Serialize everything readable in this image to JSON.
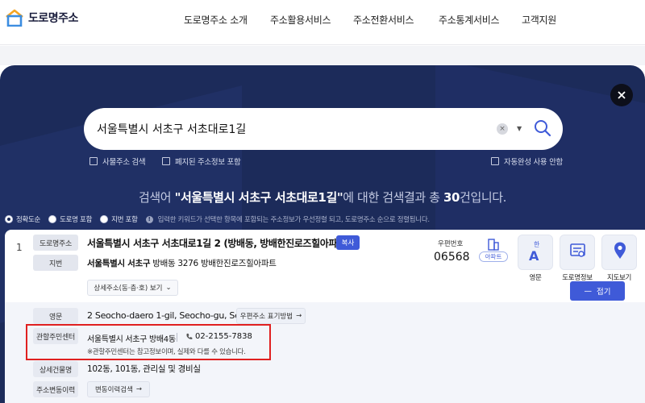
{
  "header": {
    "logo_text": "도로명주소",
    "nav": [
      "도로명주소 소개",
      "주소활용서비스",
      "주소전환서비스",
      "주소통계서비스",
      "고객지원"
    ]
  },
  "search": {
    "query": "서울특별시 서초구 서초대로1길",
    "options": {
      "private": "사물주소 검색",
      "abolished": "폐지된 주소정보 포함",
      "autocomplete": "자동완성 사용 안함"
    }
  },
  "summary": {
    "prefix": "검색어 ",
    "query_quoted": "\"서울특별시 서초구 서초대로1길\"",
    "middle": "에 대한 검색결과 총 ",
    "count": "30",
    "suffix": "건입니다."
  },
  "sort": {
    "options": [
      "정확도순",
      "도로명 포함",
      "지번 포함"
    ],
    "selected": "정확도순",
    "hint": "입력한 키워드가 선택한 항목에 포함되는 주소정보가 우선정렬 되고, 도로명주소 순으로 정렬됩니다."
  },
  "result": {
    "number": "1",
    "road_label": "도로명주소",
    "road_address": "서울특별시 서초구 서초대로1길 2 (방배동, 방배한진로즈힐아파트)",
    "copy_label": "복사",
    "jibun_label": "지번",
    "jibun_region": "서울특별시 서초구",
    "jibun_rest": " 방배동 3276 방배한진로즈힐아파트",
    "detail_button": "상세주소(동·층·호) 보기",
    "postal_label": "우편번호",
    "postal_code": "06568",
    "building_type": "아파트",
    "actions": [
      "영문",
      "도로명정보",
      "지도보기"
    ],
    "fold_label": "접기",
    "english_label": "영문",
    "english_address": "2 Seocho-daero 1-gil, Seocho-gu, Seoul",
    "english_button": "우편주소 표기방법",
    "center_label": "관할주민센터",
    "center_name": "서울특별시 서초구 방배4동",
    "center_phone": "02-2155-7838",
    "center_note": "※관할주민센터는 참고정보이며, 실제와 다를 수 있습니다.",
    "building_label": "상세건물명",
    "building_names": "102동, 101동, 관리실 및 경비실",
    "history_label": "주소변동이력",
    "history_button": "변동이력검색"
  },
  "colors": {
    "panel_bg": "#1c2b5a",
    "accent": "#3f5ad8",
    "highlight_border": "#e02020"
  }
}
